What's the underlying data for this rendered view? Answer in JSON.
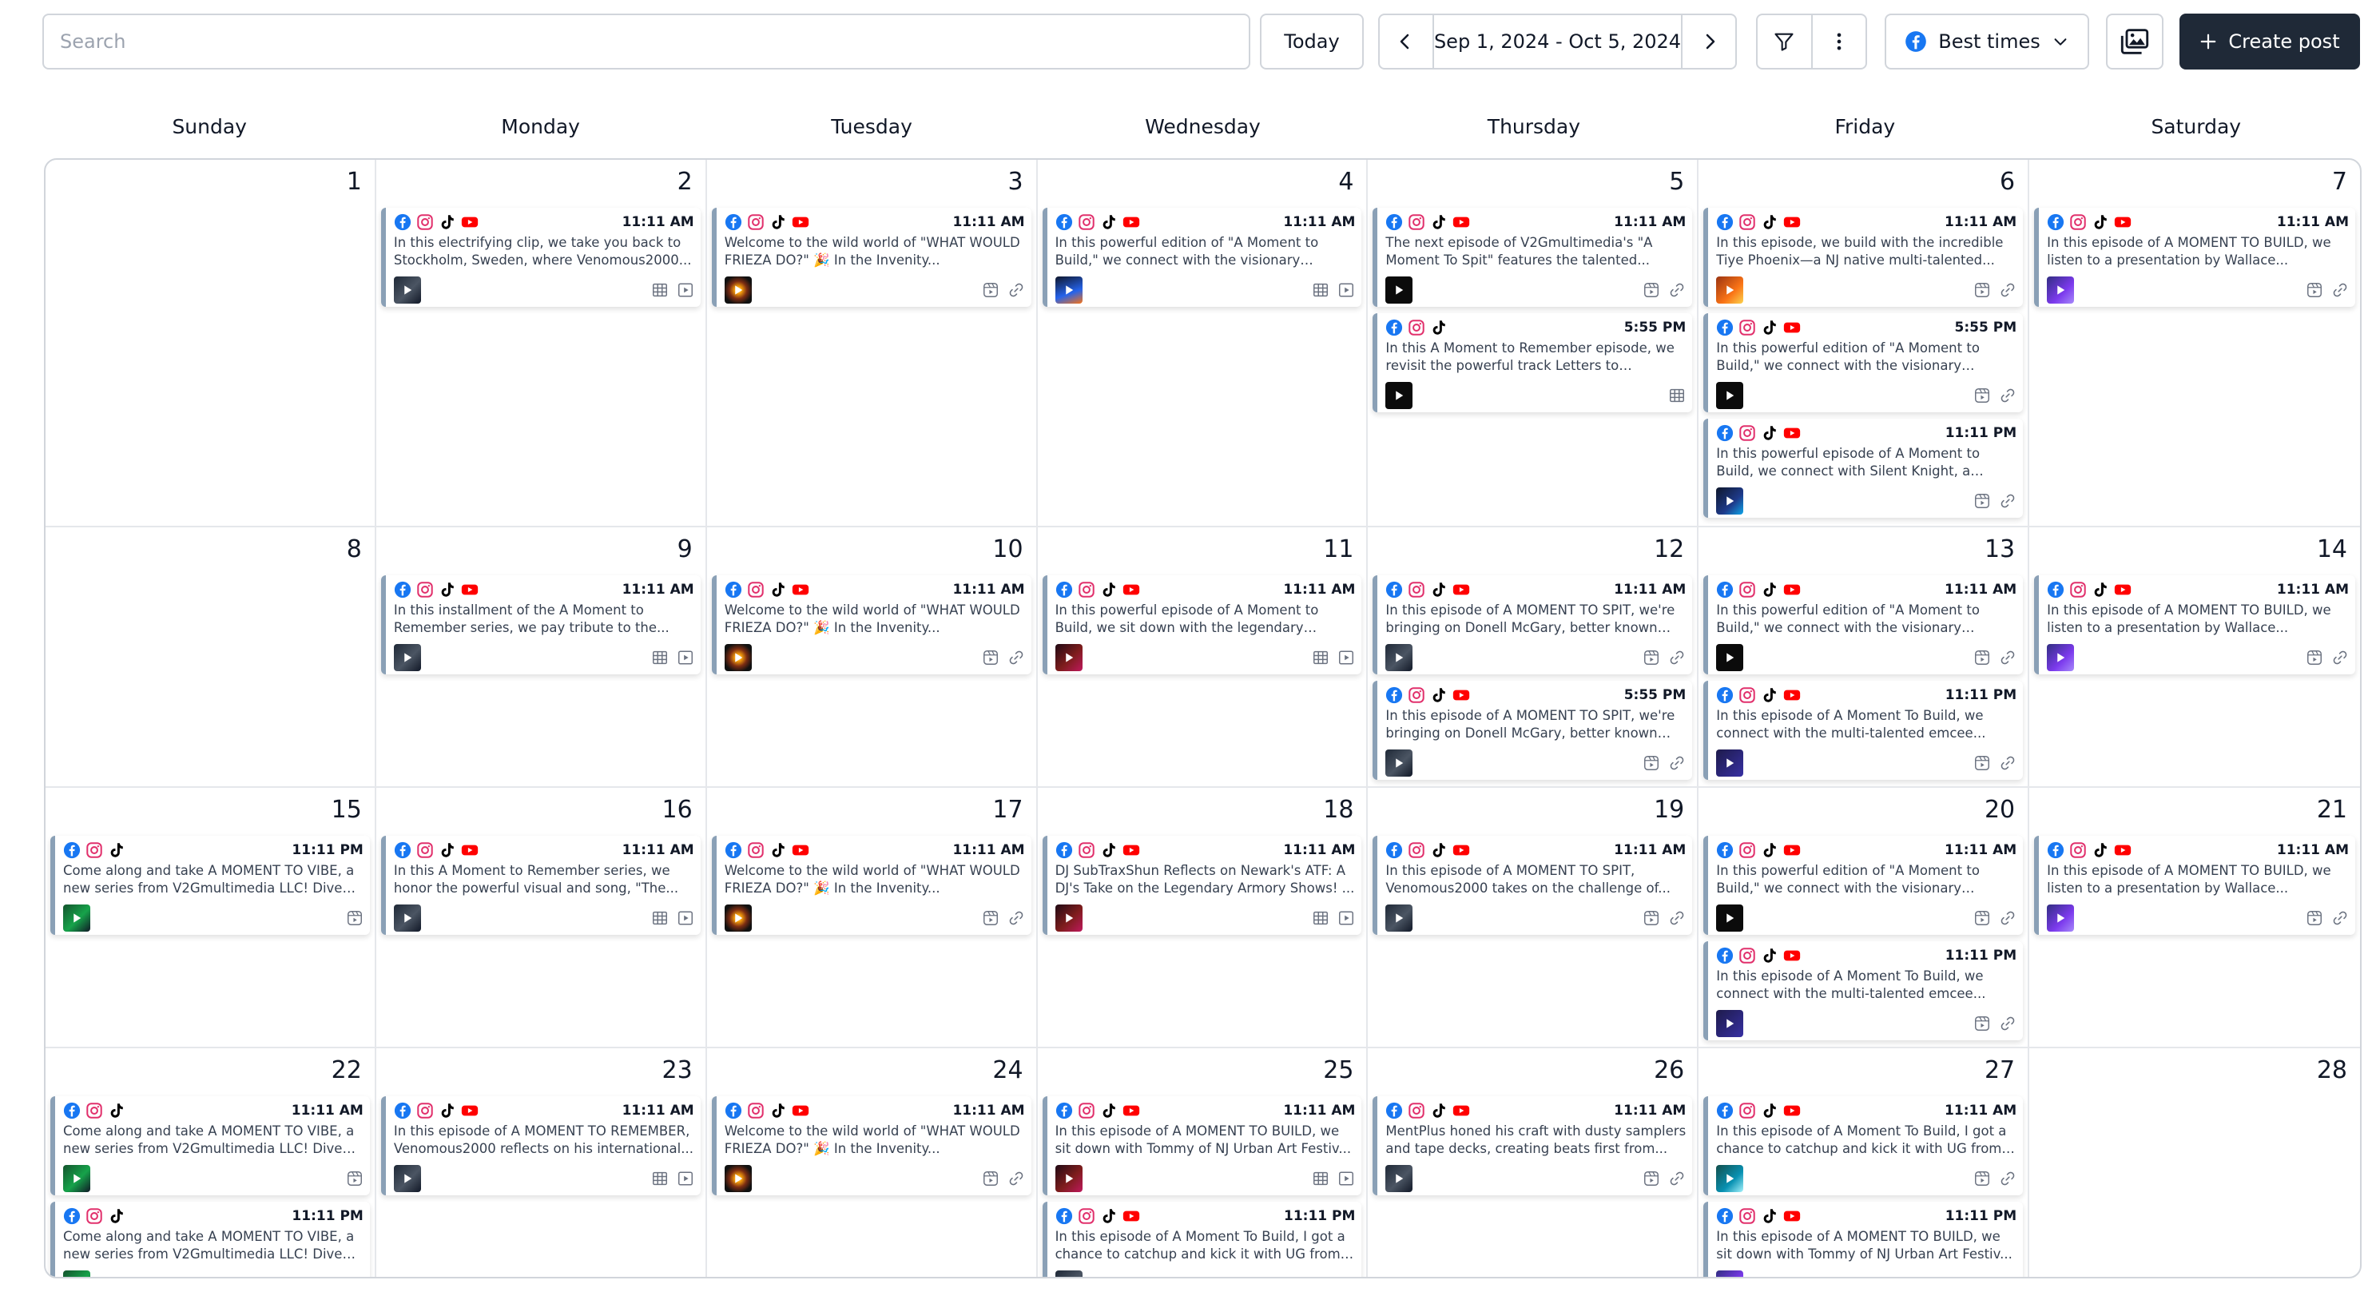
{
  "toolbar": {
    "search_placeholder": "Search",
    "today_label": "Today",
    "date_range": "Sep 1, 2024 - Oct 5, 2024",
    "best_times_label": "Best times",
    "create_post_label": "Create post"
  },
  "weekdays": [
    "Sunday",
    "Monday",
    "Tuesday",
    "Wednesday",
    "Thursday",
    "Friday",
    "Saturday"
  ],
  "colors": {
    "facebook": "#1877f2",
    "instagram": "#e1306c",
    "tiktok": "#000000",
    "youtube": "#ff0000",
    "post_accent": "#8aa0b6",
    "create_button": "#1f2937"
  },
  "weeks": [
    [
      {
        "day": "1",
        "posts": []
      },
      {
        "day": "2",
        "posts": [
          {
            "time": "11:11 AM",
            "platforms": [
              "facebook",
              "instagram",
              "tiktok",
              "youtube"
            ],
            "text": "In this electrifying clip, we take you back to Stockholm, Sweden, where Venomous2000...",
            "thumb": "dark",
            "meta": [
              "grid",
              "play"
            ]
          }
        ]
      },
      {
        "day": "3",
        "posts": [
          {
            "time": "11:11 AM",
            "platforms": [
              "facebook",
              "instagram",
              "tiktok",
              "youtube"
            ],
            "text": "Welcome to the wild world of \"WHAT WOULD FRIEZA DO?\" 🎉 In the Invenity...",
            "thumb": "burst",
            "meta": [
              "reel",
              "link"
            ]
          }
        ]
      },
      {
        "day": "4",
        "posts": [
          {
            "time": "11:11 AM",
            "platforms": [
              "facebook",
              "instagram",
              "tiktok",
              "youtube"
            ],
            "text": "In this powerful edition of \"A Moment to Build,\" we connect with the visionary behind...",
            "thumb": "blue",
            "meta": [
              "grid",
              "play"
            ]
          }
        ]
      },
      {
        "day": "5",
        "posts": [
          {
            "time": "11:11 AM",
            "platforms": [
              "facebook",
              "instagram",
              "tiktok",
              "youtube"
            ],
            "text": "The next episode of V2Gmultimedia's \"A Moment To Spit\" features the talented...",
            "thumb": "black",
            "meta": [
              "reel",
              "link"
            ]
          },
          {
            "time": "5:55 PM",
            "platforms": [
              "facebook",
              "instagram",
              "tiktok"
            ],
            "text": "In this A Moment to Remember episode, we revisit the powerful track Letters to Kaeperni...",
            "thumb": "black",
            "meta": [
              "grid"
            ]
          }
        ]
      },
      {
        "day": "6",
        "posts": [
          {
            "time": "11:11 AM",
            "platforms": [
              "facebook",
              "instagram",
              "tiktok",
              "youtube"
            ],
            "text": "In this episode, we build with the incredible Tiye Phoenix—a NJ native multi-talented...",
            "thumb": "orange",
            "meta": [
              "reel",
              "link"
            ]
          },
          {
            "time": "5:55 PM",
            "platforms": [
              "facebook",
              "instagram",
              "tiktok",
              "youtube"
            ],
            "text": "In this powerful edition of \"A Moment to Build,\" we connect with the visionary behind...",
            "thumb": "black",
            "meta": [
              "reel",
              "link"
            ]
          },
          {
            "time": "11:11 PM",
            "platforms": [
              "facebook",
              "instagram",
              "tiktok",
              "youtube"
            ],
            "text": "In this powerful episode of A Moment to Build, we connect with Silent Knight, a seasoned...",
            "thumb": "navy",
            "meta": [
              "reel",
              "link"
            ]
          }
        ]
      },
      {
        "day": "7",
        "posts": [
          {
            "time": "11:11 AM",
            "platforms": [
              "facebook",
              "instagram",
              "tiktok",
              "youtube"
            ],
            "text": "In this episode of A MOMENT TO BUILD, we listen to a presentation by Wallace...",
            "thumb": "purple",
            "meta": [
              "reel",
              "link"
            ]
          }
        ]
      }
    ],
    [
      {
        "day": "8",
        "posts": []
      },
      {
        "day": "9",
        "posts": [
          {
            "time": "11:11 AM",
            "platforms": [
              "facebook",
              "instagram",
              "tiktok",
              "youtube"
            ],
            "text": "In this installment of the A Moment to Remember series, we pay tribute to the...",
            "thumb": "dark",
            "meta": [
              "grid",
              "play"
            ]
          }
        ]
      },
      {
        "day": "10",
        "posts": [
          {
            "time": "11:11 AM",
            "platforms": [
              "facebook",
              "instagram",
              "tiktok",
              "youtube"
            ],
            "text": "Welcome to the wild world of \"WHAT WOULD FRIEZA DO?\" 🎉 In the Invenity...",
            "thumb": "burst",
            "meta": [
              "reel",
              "link"
            ]
          }
        ]
      },
      {
        "day": "11",
        "posts": [
          {
            "time": "11:11 AM",
            "platforms": [
              "facebook",
              "instagram",
              "tiktok",
              "youtube"
            ],
            "text": "In this powerful episode of A Moment to Build, we sit down with the legendary L.I.F.E.Long t...",
            "thumb": "maroon",
            "meta": [
              "grid",
              "play"
            ]
          }
        ]
      },
      {
        "day": "12",
        "posts": [
          {
            "time": "11:11 AM",
            "platforms": [
              "facebook",
              "instagram",
              "tiktok",
              "youtube"
            ],
            "text": "In this episode of A MOMENT TO SPIT, we're bringing on Donell McGary, better known as...",
            "thumb": "dark",
            "meta": [
              "reel",
              "link"
            ]
          },
          {
            "time": "5:55 PM",
            "platforms": [
              "facebook",
              "instagram",
              "tiktok",
              "youtube"
            ],
            "text": "In this episode of A MOMENT TO SPIT, we're bringing on Donell McGary, better known as...",
            "thumb": "dark",
            "meta": [
              "reel",
              "link"
            ]
          }
        ]
      },
      {
        "day": "13",
        "posts": [
          {
            "time": "11:11 AM",
            "platforms": [
              "facebook",
              "instagram",
              "tiktok",
              "youtube"
            ],
            "text": "In this powerful edition of \"A Moment to Build,\" we connect with the visionary behind...",
            "thumb": "black",
            "meta": [
              "reel",
              "link"
            ]
          },
          {
            "time": "11:11 PM",
            "platforms": [
              "facebook",
              "instagram",
              "tiktok",
              "youtube"
            ],
            "text": "In this episode of A Moment To Build, we connect with the multi-talented emcee...",
            "thumb": "indigo",
            "meta": [
              "reel",
              "link"
            ]
          }
        ]
      },
      {
        "day": "14",
        "posts": [
          {
            "time": "11:11 AM",
            "platforms": [
              "facebook",
              "instagram",
              "tiktok",
              "youtube"
            ],
            "text": "In this episode of A MOMENT TO BUILD, we listen to a presentation by Wallace...",
            "thumb": "purple",
            "meta": [
              "reel",
              "link"
            ]
          }
        ]
      }
    ],
    [
      {
        "day": "15",
        "posts": [
          {
            "time": "11:11 PM",
            "platforms": [
              "facebook",
              "instagram",
              "tiktok"
            ],
            "text": "Come along and take A MOMENT TO VIBE, a new series from V2Gmultimedia LLC! Dive in...",
            "thumb": "green",
            "meta": [
              "reel"
            ]
          }
        ]
      },
      {
        "day": "16",
        "posts": [
          {
            "time": "11:11 AM",
            "platforms": [
              "facebook",
              "instagram",
              "tiktok",
              "youtube"
            ],
            "text": "In this A Moment to Remember series, we honor the powerful visual and song, \"The...",
            "thumb": "dark",
            "meta": [
              "grid",
              "play"
            ]
          }
        ]
      },
      {
        "day": "17",
        "posts": [
          {
            "time": "11:11 AM",
            "platforms": [
              "facebook",
              "instagram",
              "tiktok",
              "youtube"
            ],
            "text": "Welcome to the wild world of \"WHAT WOULD FRIEZA DO?\" 🎉 In the Invenity...",
            "thumb": "burst",
            "meta": [
              "reel",
              "link"
            ]
          }
        ]
      },
      {
        "day": "18",
        "posts": [
          {
            "time": "11:11 AM",
            "platforms": [
              "facebook",
              "instagram",
              "tiktok",
              "youtube"
            ],
            "text": "DJ SubTraxShun Reflects on Newark's ATF: A DJ's Take on the Legendary Armory Shows! ...",
            "thumb": "maroon",
            "meta": [
              "grid",
              "play"
            ]
          }
        ]
      },
      {
        "day": "19",
        "posts": [
          {
            "time": "11:11 AM",
            "platforms": [
              "facebook",
              "instagram",
              "tiktok",
              "youtube"
            ],
            "text": "In this episode of A MOMENT TO SPIT, Venomous2000 takes on the challenge of...",
            "thumb": "dark",
            "meta": [
              "reel",
              "link"
            ]
          }
        ]
      },
      {
        "day": "20",
        "posts": [
          {
            "time": "11:11 AM",
            "platforms": [
              "facebook",
              "instagram",
              "tiktok",
              "youtube"
            ],
            "text": "In this powerful edition of \"A Moment to Build,\" we connect with the visionary behind...",
            "thumb": "black",
            "meta": [
              "reel",
              "link"
            ]
          },
          {
            "time": "11:11 PM",
            "platforms": [
              "facebook",
              "instagram",
              "tiktok",
              "youtube"
            ],
            "text": "In this episode of A Moment To Build, we connect with the multi-talented emcee...",
            "thumb": "indigo",
            "meta": [
              "reel",
              "link"
            ]
          }
        ]
      },
      {
        "day": "21",
        "posts": [
          {
            "time": "11:11 AM",
            "platforms": [
              "facebook",
              "instagram",
              "tiktok",
              "youtube"
            ],
            "text": "In this episode of A MOMENT TO BUILD, we listen to a presentation by Wallace...",
            "thumb": "purple",
            "meta": [
              "reel",
              "link"
            ]
          }
        ]
      }
    ],
    [
      {
        "day": "22",
        "posts": [
          {
            "time": "11:11 AM",
            "platforms": [
              "facebook",
              "instagram",
              "tiktok"
            ],
            "text": "Come along and take A MOMENT TO VIBE, a new series from V2Gmultimedia LLC! Dive in...",
            "thumb": "green",
            "meta": [
              "reel"
            ]
          },
          {
            "time": "11:11 PM",
            "platforms": [
              "facebook",
              "instagram",
              "tiktok"
            ],
            "text": "Come along and take A MOMENT TO VIBE, a new series from V2Gmultimedia LLC! Dive in...",
            "thumb": "green",
            "meta": [
              "reel"
            ]
          }
        ]
      },
      {
        "day": "23",
        "posts": [
          {
            "time": "11:11 AM",
            "platforms": [
              "facebook",
              "instagram",
              "tiktok",
              "youtube"
            ],
            "text": "In this episode of A MOMENT TO REMEMBER, Venomous2000 reflects on his international...",
            "thumb": "dark",
            "meta": [
              "grid",
              "play"
            ]
          }
        ]
      },
      {
        "day": "24",
        "posts": [
          {
            "time": "11:11 AM",
            "platforms": [
              "facebook",
              "instagram",
              "tiktok",
              "youtube"
            ],
            "text": "Welcome to the wild world of \"WHAT WOULD FRIEZA DO?\" 🎉 In the Invenity...",
            "thumb": "burst",
            "meta": [
              "reel",
              "link"
            ]
          }
        ]
      },
      {
        "day": "25",
        "posts": [
          {
            "time": "11:11 AM",
            "platforms": [
              "facebook",
              "instagram",
              "tiktok",
              "youtube"
            ],
            "text": "In this episode of A MOMENT TO BUILD, we sit down with Tommy of NJ Urban Art Festiv...",
            "thumb": "maroon",
            "meta": [
              "grid",
              "play"
            ]
          },
          {
            "time": "11:11 PM",
            "platforms": [
              "facebook",
              "instagram",
              "tiktok",
              "youtube"
            ],
            "text": "In this episode of A Moment To Build, I got a chance to catchup and kick it with UG from t...",
            "thumb": "dark",
            "meta": [
              "reel",
              "link"
            ]
          }
        ]
      },
      {
        "day": "26",
        "posts": [
          {
            "time": "11:11 AM",
            "platforms": [
              "facebook",
              "instagram",
              "tiktok",
              "youtube"
            ],
            "text": "MentPlus honed his craft with dusty samplers and tape decks, creating beats first from...",
            "thumb": "dark",
            "meta": [
              "reel",
              "link"
            ]
          }
        ]
      },
      {
        "day": "27",
        "posts": [
          {
            "time": "11:11 AM",
            "platforms": [
              "facebook",
              "instagram",
              "tiktok",
              "youtube"
            ],
            "text": "In this episode of A Moment To Build, I got a chance to catchup and kick it with UG from t...",
            "thumb": "teal",
            "meta": [
              "reel",
              "link"
            ]
          },
          {
            "time": "11:11 PM",
            "platforms": [
              "facebook",
              "instagram",
              "tiktok",
              "youtube"
            ],
            "text": "In this episode of A MOMENT TO BUILD, we sit down with Tommy of NJ Urban Art Festiv...",
            "thumb": "purple",
            "meta": [
              "reel",
              "link"
            ]
          }
        ]
      },
      {
        "day": "28",
        "posts": []
      }
    ]
  ]
}
